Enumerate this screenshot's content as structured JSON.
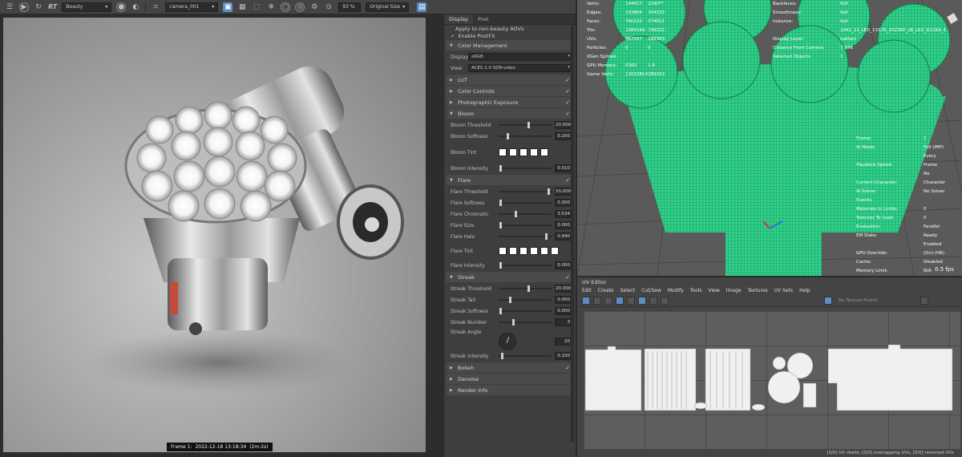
{
  "toolbar": {
    "rt_label": "RT",
    "pass_select": "Beauty",
    "camera_select": "camera_001",
    "zoom_value": "93 %",
    "size_select": "Original Size"
  },
  "render": {
    "frame_label": "Frame 1:",
    "timestamp": "2022-12-18 13:18:34",
    "duration": "(2m:2s)"
  },
  "panel": {
    "tabs": [
      "Display",
      "Post"
    ],
    "apply_non_beauty": "Apply to non-beauty AOVs",
    "enable_postfx": "Enable PostFX",
    "color_management": {
      "title": "Color Management",
      "display_label": "Display",
      "display_value": "sRGB",
      "view_label": "View",
      "view_value": "ACES 1.0 SDR-video"
    },
    "lut": "LUT",
    "color_controls": "Color Controls",
    "photographic_exposure": "Photographic Exposure",
    "bloom": {
      "title": "Bloom",
      "threshold_label": "Bloom Threshold",
      "threshold_value": "20.000",
      "softness_label": "Bloom Softness",
      "softness_value": "0.200",
      "tint_label": "Bloom Tint",
      "intensity_label": "Bloom Intensity",
      "intensity_value": "0.010"
    },
    "flare": {
      "title": "Flare",
      "threshold_label": "Flare Threshold",
      "threshold_value": "50.000",
      "softness_label": "Flare Softness",
      "softness_value": "0.000",
      "chromatic_label": "Flare Chromatic",
      "chromatic_value": "3.534",
      "size_label": "Flare Size",
      "size_value": "0.000",
      "halo_label": "Flare Halo",
      "halo_value": "0.940",
      "tint_label": "Flare Tint",
      "intensity_label": "Flare Intensity",
      "intensity_value": "0.000"
    },
    "streak": {
      "title": "Streak",
      "threshold_label": "Streak Threshold",
      "threshold_value": "20.000",
      "tail_label": "Streak Tail",
      "tail_value": "0.000",
      "softness_label": "Streak Softness",
      "softness_value": "0.000",
      "number_label": "Streak Number",
      "number_value": "3",
      "angle_label": "Streak Angle",
      "angle_value": "20",
      "intensity_label": "Streak Intensity",
      "intensity_value": "0.100"
    },
    "bokeh": "Bokeh",
    "denoise": "Denoise",
    "render_info": "Render Info"
  },
  "viewport": {
    "stats_left": [
      {
        "k": "Verts:",
        "v1": "144417",
        "v2": "2240**"
      },
      {
        "k": "Edges:",
        "v1": "103804",
        "v2": "344332"
      },
      {
        "k": "Faces:",
        "v1": "740222",
        "v2": "374611"
      },
      {
        "k": "Tris:",
        "v1": "1584344",
        "v2": "749222"
      },
      {
        "k": "UVs:",
        "v1": "867557",
        "v2": "289163"
      },
      {
        "k": "Particles:",
        "v1": "0",
        "v2": "0"
      },
      {
        "k": "XGen Splines:",
        "v1": "",
        "v2": ""
      },
      {
        "k": "GPU Memory:",
        "v1": "6160",
        "v2": "1.4"
      },
      {
        "k": "Game Verts:",
        "v1": "13022814",
        "v2": "289163"
      }
    ],
    "stats_right_top": [
      {
        "k": "Backfaces:",
        "v": "N/A"
      },
      {
        "k": "Smoothness:",
        "v": "N/A"
      },
      {
        "k": "Instance:",
        "v": "N/A"
      },
      {
        "k": "Display Layer:",
        "v": "1041_13_LED_1157R_SYZ36P_LB_LED_D1164_4 baklam"
      },
      {
        "k": "Distance From Camera:",
        "v": "7.978"
      },
      {
        "k": "Selected Objects:",
        "v": "1"
      }
    ],
    "stats_right_bottom": [
      {
        "k": "Frame:",
        "v": "1"
      },
      {
        "k": "IK Mode:",
        "v": "Full (IMP)"
      },
      {
        "k": "Playback Speed:",
        "v": "Every Frame"
      },
      {
        "k": "Current Character:",
        "v": "No Character"
      },
      {
        "k": "IK Solver:",
        "v": "No Solver"
      },
      {
        "k": "Events:",
        "v": ""
      },
      {
        "k": "Materials In Limbo:",
        "v": "0"
      },
      {
        "k": "Textures To Load:",
        "v": "0"
      },
      {
        "k": "Evaluation:",
        "v": "Parallel"
      },
      {
        "k": "EM State:",
        "v": "Ready"
      },
      {
        "k": "GPU Override:",
        "v": "Enabled (On) (HR)"
      },
      {
        "k": "Cache:",
        "v": "Disabled"
      },
      {
        "k": "Memory Limit:",
        "v": "N/A"
      },
      {
        "k": "GPU Memory Limit:",
        "v": "N/A"
      }
    ],
    "fps": "0.5 fps"
  },
  "uv_editor": {
    "title": "UV Editor",
    "menu": [
      "Edit",
      "Create",
      "Select",
      "Cut/Sew",
      "Modify",
      "Tools",
      "View",
      "Image",
      "Textures",
      "UV Sets",
      "Help"
    ],
    "textures_select": "No Texture Found",
    "status": "[0/0] UV shells, [0/0] overlapping UVs, [0/0] reversed UVs"
  }
}
